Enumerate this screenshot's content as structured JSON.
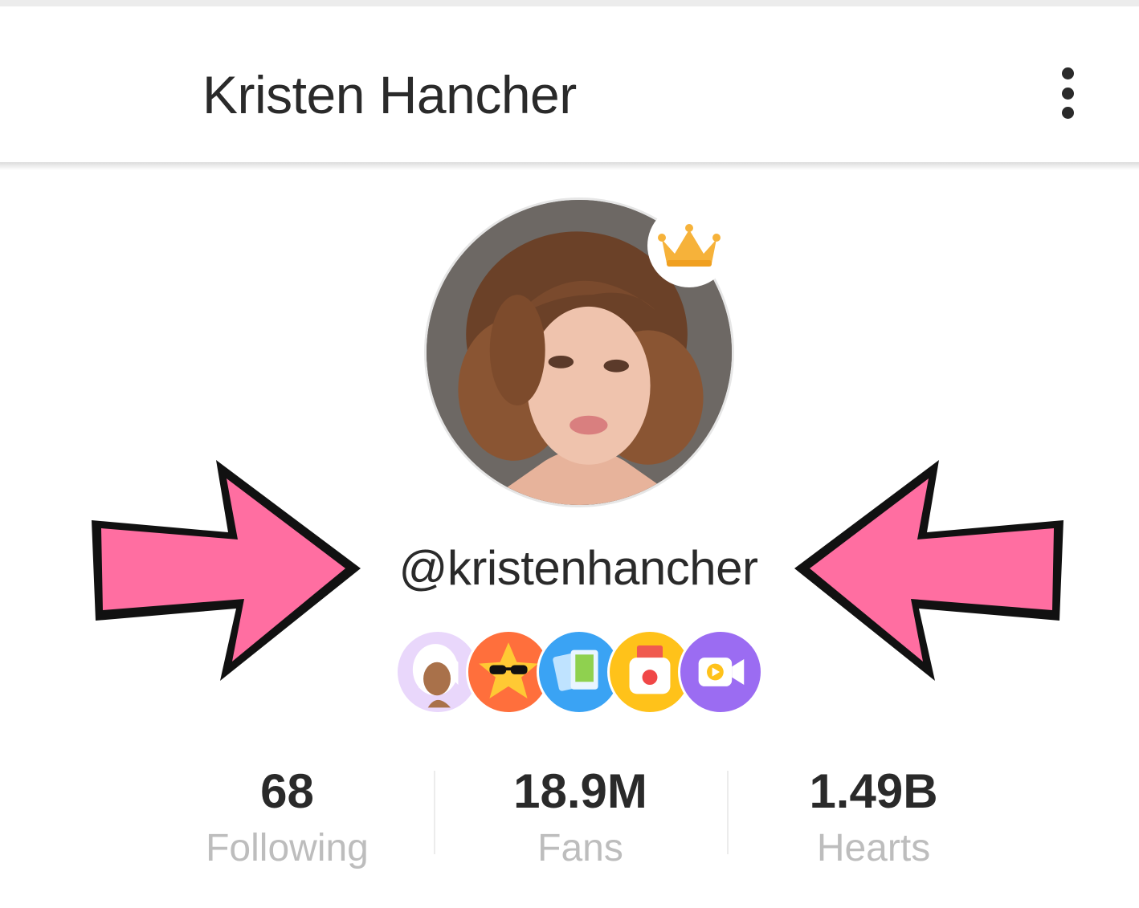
{
  "header": {
    "title": "Kristen Hancher",
    "menu_icon": "more-vertical-icon"
  },
  "profile": {
    "username": "@kristenhancher",
    "avatar_alt": "profile photo",
    "crown_icon": "crown-icon"
  },
  "badges": [
    {
      "icon": "avatar-badge-icon",
      "color": "#e9d7fb"
    },
    {
      "icon": "star-sunglasses-badge-icon",
      "color": "#ff6f3c"
    },
    {
      "icon": "cards-badge-icon",
      "color": "#3aa3f4"
    },
    {
      "icon": "camera-record-badge-icon",
      "color": "#ffc21a"
    },
    {
      "icon": "video-badge-icon",
      "color": "#9b6cf2"
    }
  ],
  "annotations": {
    "arrow_color": "#ff6ea1",
    "arrow_outline": "#111111"
  },
  "stats": [
    {
      "value": "68",
      "label": "Following"
    },
    {
      "value": "18.9M",
      "label": "Fans"
    },
    {
      "value": "1.49B",
      "label": "Hearts"
    }
  ]
}
